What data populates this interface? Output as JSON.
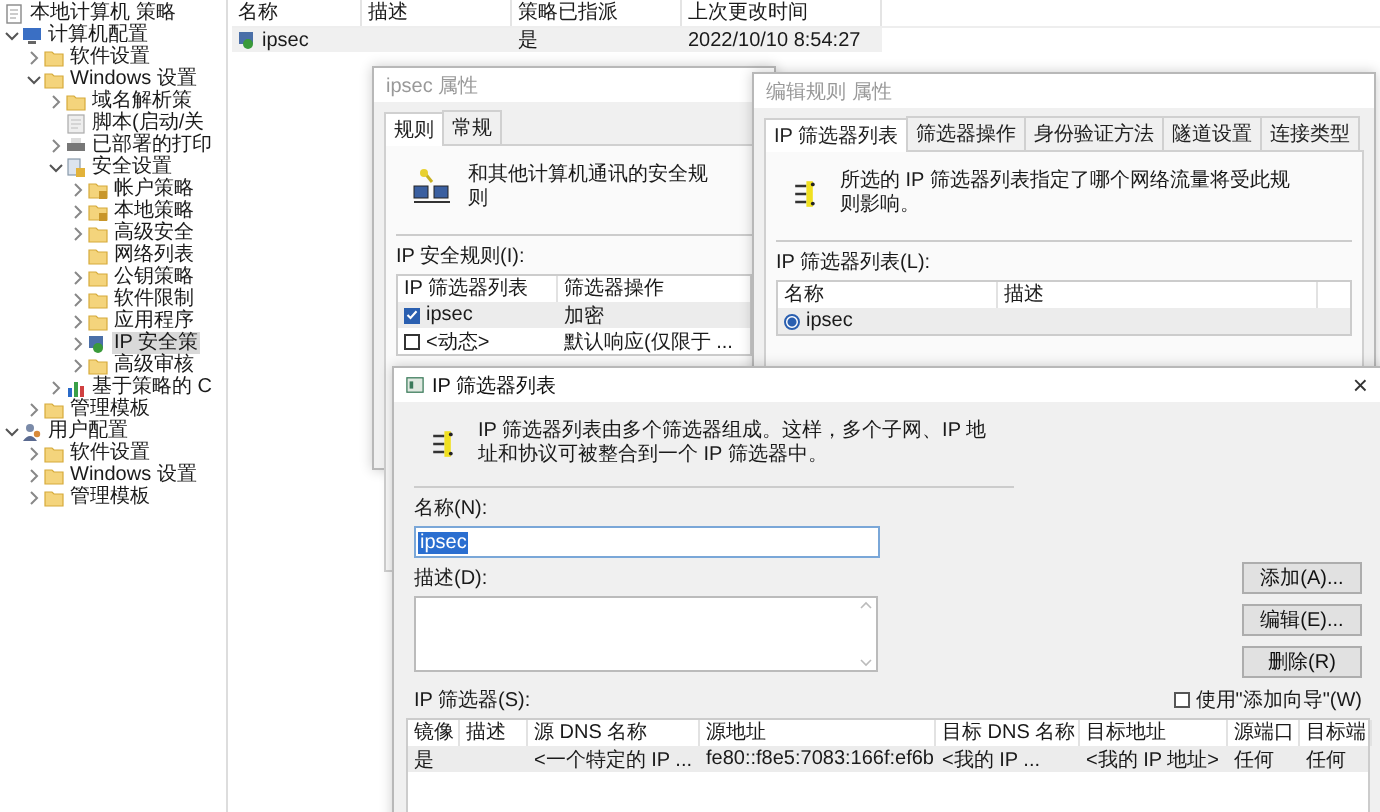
{
  "tree": [
    {
      "label": "本地计算机 策略",
      "kind": "policy",
      "selected": false,
      "children": [
        {
          "label": "计算机配置",
          "kind": "computer",
          "expanded": true,
          "selected": false,
          "children": [
            {
              "label": "软件设置",
              "kind": "folder",
              "expanded": false,
              "selected": false
            },
            {
              "label": "Windows 设置",
              "kind": "folder",
              "expanded": true,
              "selected": false,
              "children": [
                {
                  "label": "域名解析策",
                  "kind": "folder",
                  "expanded": false,
                  "selected": false
                },
                {
                  "label": "脚本(启动/关",
                  "kind": "script",
                  "selected": false
                },
                {
                  "label": "已部署的打印",
                  "kind": "printer",
                  "expanded": false,
                  "selected": false
                },
                {
                  "label": "安全设置",
                  "kind": "security",
                  "expanded": true,
                  "selected": false,
                  "children": [
                    {
                      "label": "帐户策略",
                      "kind": "folder-lock",
                      "expanded": false,
                      "selected": false
                    },
                    {
                      "label": "本地策略",
                      "kind": "folder-lock",
                      "expanded": false,
                      "selected": false
                    },
                    {
                      "label": "高级安全",
                      "kind": "folder",
                      "expanded": false,
                      "selected": false
                    },
                    {
                      "label": "网络列表",
                      "kind": "folder",
                      "selected": false
                    },
                    {
                      "label": "公钥策略",
                      "kind": "folder",
                      "expanded": false,
                      "selected": false
                    },
                    {
                      "label": "软件限制",
                      "kind": "folder",
                      "expanded": false,
                      "selected": false
                    },
                    {
                      "label": "应用程序",
                      "kind": "folder",
                      "expanded": false,
                      "selected": false
                    },
                    {
                      "label": "IP 安全策",
                      "kind": "ipsec",
                      "expanded": false,
                      "selected": true
                    },
                    {
                      "label": "高级审核",
                      "kind": "folder",
                      "expanded": false,
                      "selected": false
                    }
                  ]
                },
                {
                  "label": "基于策略的 C",
                  "kind": "chart",
                  "expanded": false,
                  "selected": false
                }
              ]
            },
            {
              "label": "管理模板",
              "kind": "folder",
              "expanded": false,
              "selected": false
            }
          ]
        },
        {
          "label": "用户配置",
          "kind": "user",
          "expanded": true,
          "selected": false,
          "children": [
            {
              "label": "软件设置",
              "kind": "folder",
              "expanded": false,
              "selected": false
            },
            {
              "label": "Windows 设置",
              "kind": "folder",
              "expanded": false,
              "selected": false
            },
            {
              "label": "管理模板",
              "kind": "folder",
              "expanded": false,
              "selected": false
            }
          ]
        }
      ]
    }
  ],
  "list": {
    "columns": [
      "名称",
      "描述",
      "策略已指派",
      "上次更改时间"
    ],
    "rows": [
      {
        "cells": [
          "ipsec",
          "",
          "是",
          "2022/10/10 8:54:27"
        ]
      }
    ]
  },
  "policy_dialog": {
    "title": "ipsec 属性",
    "active": false,
    "tabs": [
      {
        "label": "规则",
        "selected": true
      },
      {
        "label": "常规",
        "selected": false
      }
    ],
    "intro": "和其他计算机通讯的安全规则",
    "rules_label": "IP 安全规则(I):",
    "columns": [
      "IP 筛选器列表",
      "筛选器操作"
    ],
    "rows": [
      {
        "checked": true,
        "selected": true,
        "cells": [
          "ipsec",
          "加密"
        ]
      },
      {
        "checked": false,
        "selected": false,
        "cells": [
          "<动态>",
          "默认响应(仅限于 ..."
        ]
      }
    ]
  },
  "rule_dialog": {
    "title": "编辑规则 属性",
    "active": false,
    "tabs": [
      {
        "label": "IP 筛选器列表",
        "selected": true
      },
      {
        "label": "筛选器操作",
        "selected": false
      },
      {
        "label": "身份验证方法",
        "selected": false
      },
      {
        "label": "隧道设置",
        "selected": false
      },
      {
        "label": "连接类型",
        "selected": false
      }
    ],
    "intro": "所选的 IP 筛选器列表指定了哪个网络流量将受此规则影响。",
    "list_label": "IP 筛选器列表(L):",
    "columns": [
      "名称",
      "描述"
    ],
    "rows": [
      {
        "selected": true,
        "cells": [
          "ipsec",
          ""
        ]
      }
    ]
  },
  "filter_list_dialog": {
    "title": "IP 筛选器列表",
    "active": true,
    "close": "×",
    "intro": "IP 筛选器列表由多个筛选器组成。这样，多个子网、IP 地址和协议可被整合到一个 IP 筛选器中。",
    "name_label": "名称(N):",
    "name_value": "ipsec",
    "name_value_selected": true,
    "description_label": "描述(D):",
    "buttons": [
      "添加(A)...",
      "编辑(E)...",
      "删除(R)"
    ],
    "wizard": {
      "label": "使用\"添加向导\"(W)",
      "checked": false
    },
    "filters_label": "IP 筛选器(S):",
    "columns": [
      "镜像",
      "描述",
      "源 DNS 名称",
      "源地址",
      "目标 DNS 名称",
      "目标地址",
      "源端口",
      "目标端"
    ],
    "rows": [
      {
        "cells": [
          "是",
          "",
          "<一个特定的 IP ...",
          "fe80::f8e5:7083:166f:ef6b",
          "<我的 IP ...",
          "<我的 IP 地址>",
          "任何",
          "任何"
        ]
      }
    ]
  }
}
